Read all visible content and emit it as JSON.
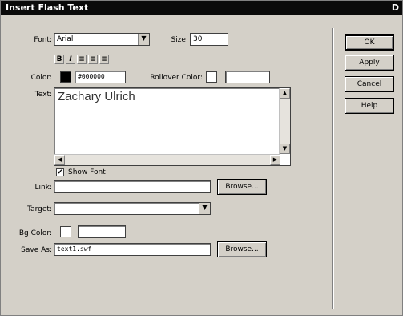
{
  "window": {
    "title": "Insert Flash Text",
    "close_glyph": "D"
  },
  "font": {
    "label": "Font:",
    "value": "Arial"
  },
  "size": {
    "label": "Size:",
    "value": "30"
  },
  "format": {
    "bold": "B",
    "italic": "I",
    "align_left": "≡",
    "align_center": "≡",
    "align_right": "≡"
  },
  "color": {
    "label": "Color:",
    "swatch_color": "#000000",
    "hex": "#000000"
  },
  "rollover": {
    "label": "Rollover Color:",
    "value": ""
  },
  "text": {
    "label": "Text:",
    "value": "Zachary Ulrich"
  },
  "show_font": {
    "label": "Show Font",
    "checked": true,
    "mark": "✔"
  },
  "link": {
    "label": "Link:",
    "value": "",
    "browse": "Browse..."
  },
  "target": {
    "label": "Target:",
    "value": ""
  },
  "bg_color": {
    "label": "Bg Color:",
    "value": ""
  },
  "save_as": {
    "label": "Save As:",
    "value": "text1.swf",
    "browse": "Browse..."
  },
  "buttons": {
    "ok": "OK",
    "apply": "Apply",
    "cancel": "Cancel",
    "help": "Help"
  }
}
